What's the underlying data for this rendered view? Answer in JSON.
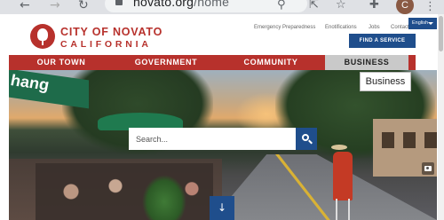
{
  "browser": {
    "url_host": "novato.org",
    "url_path": "/home",
    "profile_initial": "C",
    "icons": [
      "back-arrow-icon",
      "forward-arrow-icon",
      "reload-icon",
      "lock-icon",
      "zoom-icon",
      "share-icon",
      "star-icon",
      "extensions-icon",
      "profile-avatar",
      "kebab-menu-icon"
    ]
  },
  "header": {
    "logo_line1": "CITY OF NOVATO",
    "logo_line2": "CALIFORNIA",
    "utility_links": [
      "Emergency Preparedness",
      "Enotifications",
      "Jobs",
      "Contact Us"
    ],
    "language_label": "English",
    "find_service_label": "FIND A SERVICE"
  },
  "nav": {
    "items": [
      "OUR TOWN",
      "GOVERNMENT",
      "COMMUNITY",
      "BUSINESS"
    ],
    "tooltip": "Business"
  },
  "hero": {
    "search_placeholder": "Search...",
    "awning_text": "hang",
    "scroll_label": "↓"
  },
  "colors": {
    "brand_red": "#b7312c",
    "brand_blue": "#1f4e8c",
    "nav_active": "#c9c9c9"
  }
}
